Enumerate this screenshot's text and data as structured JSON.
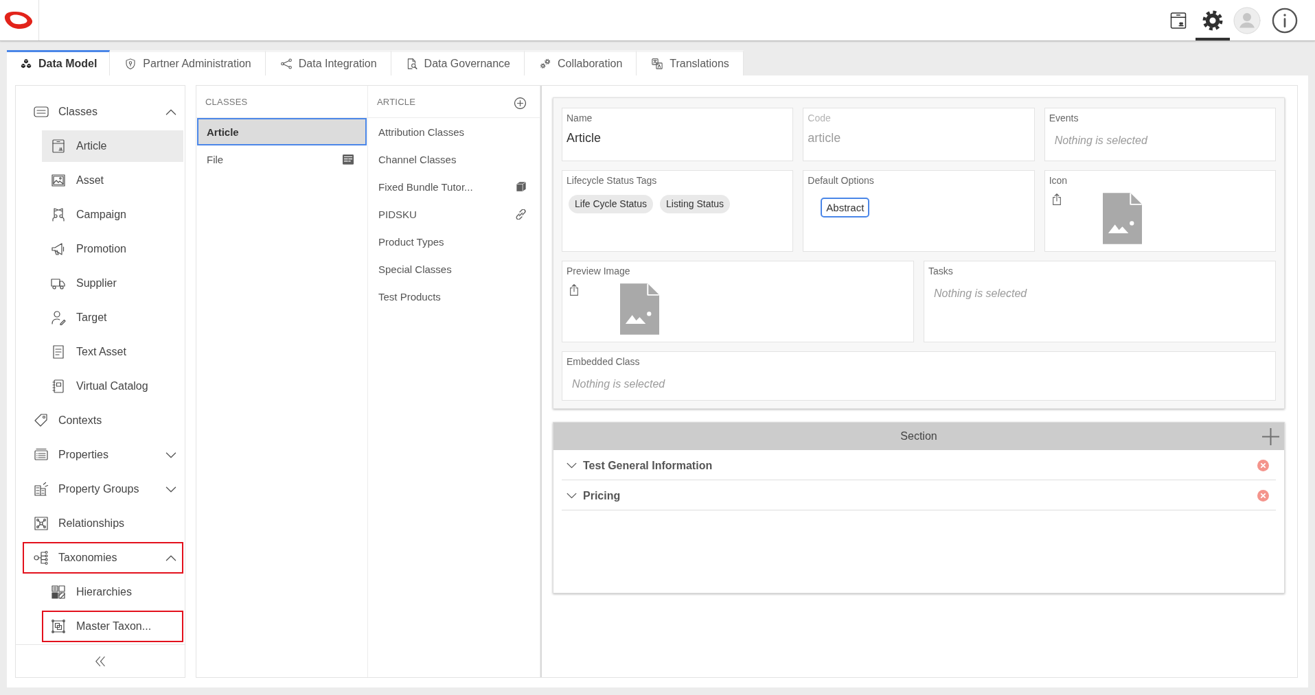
{
  "top_bar": {
    "toolbar": [
      {
        "kind": "package",
        "selected": false
      },
      {
        "kind": "settings",
        "selected": true
      },
      {
        "kind": "account",
        "selected": false
      },
      {
        "kind": "info",
        "selected": false
      }
    ]
  },
  "tabs": [
    {
      "label": "Data Model",
      "selected": true
    },
    {
      "label": "Partner Administration",
      "selected": false
    },
    {
      "label": "Data Integration",
      "selected": false
    },
    {
      "label": "Data Governance",
      "selected": false
    },
    {
      "label": "Collaboration",
      "selected": false
    },
    {
      "label": "Translations",
      "selected": false
    }
  ],
  "sidebar": {
    "items": [
      {
        "label": "Classes",
        "expanded": true,
        "selected": false,
        "highlighted": false,
        "children": [
          {
            "label": "Article",
            "selected": true,
            "highlighted": false
          },
          {
            "label": "Asset",
            "selected": false,
            "highlighted": false
          },
          {
            "label": "Campaign",
            "selected": false,
            "highlighted": false
          },
          {
            "label": "Promotion",
            "selected": false,
            "highlighted": false
          },
          {
            "label": "Supplier",
            "selected": false,
            "highlighted": false
          },
          {
            "label": "Target",
            "selected": false,
            "highlighted": false
          },
          {
            "label": "Text Asset",
            "selected": false,
            "highlighted": false
          },
          {
            "label": "Virtual Catalog",
            "selected": false,
            "highlighted": false
          }
        ]
      },
      {
        "label": "Contexts",
        "selected": false,
        "highlighted": false
      },
      {
        "label": "Properties",
        "expanded": false,
        "selected": false,
        "highlighted": false
      },
      {
        "label": "Property Groups",
        "expanded": false,
        "selected": false,
        "highlighted": false
      },
      {
        "label": "Relationships",
        "selected": false,
        "highlighted": false
      },
      {
        "label": "Taxonomies",
        "expanded": true,
        "selected": false,
        "highlighted": true,
        "children": [
          {
            "label": "Hierarchies",
            "selected": false,
            "highlighted": false
          },
          {
            "label": "Master Taxon...",
            "selected": false,
            "highlighted": true
          }
        ]
      }
    ]
  },
  "classes": {
    "header": "CLASSES",
    "rows": [
      {
        "label": "Article",
        "kind": "plain",
        "selected": true
      },
      {
        "label": "File",
        "kind": "file",
        "selected": false
      }
    ]
  },
  "article": {
    "header": "ARTICLE",
    "rows": [
      {
        "label": "Attribution Classes",
        "kind": "plain",
        "selected": false
      },
      {
        "label": "Channel Classes",
        "kind": "plain",
        "selected": false
      },
      {
        "label": "Fixed Bundle Tutor...",
        "kind": "bundle",
        "selected": false
      },
      {
        "label": "PIDSKU",
        "kind": "linked",
        "selected": false
      },
      {
        "label": "Product Types",
        "kind": "plain",
        "selected": false
      },
      {
        "label": "Special Classes",
        "kind": "plain",
        "selected": false
      },
      {
        "label": "Test Products",
        "kind": "plain",
        "selected": false
      }
    ]
  },
  "details": {
    "rows": [
      [
        {
          "label": "Name",
          "kind": "text",
          "value": "Article",
          "disabled": false
        },
        {
          "label": "Code",
          "kind": "text",
          "value": "article",
          "disabled": true
        },
        {
          "label": "Events",
          "kind": "select",
          "placeholder": "Nothing is selected"
        }
      ],
      [
        {
          "label": "Lifecycle Status Tags",
          "kind": "tags",
          "tags": [
            "Life Cycle Status",
            "Listing Status"
          ]
        },
        {
          "label": "Default Options",
          "kind": "options",
          "options": [
            {
              "label": "Abstract",
              "selected": true
            }
          ]
        },
        {
          "label": "Icon",
          "kind": "image"
        }
      ],
      [
        {
          "label": "Preview Image",
          "kind": "image"
        },
        {
          "label": "Tasks",
          "kind": "select",
          "placeholder": "Nothing is selected"
        }
      ],
      [
        {
          "label": "Embedded Class",
          "kind": "select",
          "placeholder": "Nothing is selected"
        }
      ]
    ]
  },
  "section": {
    "title": "Section",
    "items": [
      {
        "label": "Test General Information",
        "expanded": false
      },
      {
        "label": "Pricing",
        "expanded": false
      }
    ]
  }
}
